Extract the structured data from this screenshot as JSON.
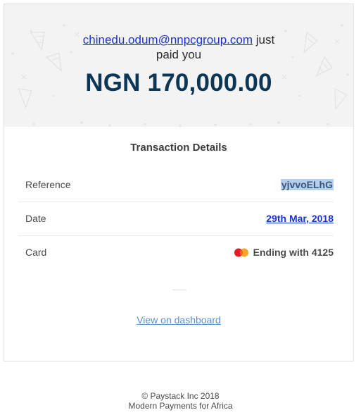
{
  "hero": {
    "email": "chinedu.odum@nnpcgroup.com",
    "paid_text_1": "just",
    "paid_text_2": "paid you",
    "amount": "NGN 170,000.00"
  },
  "details": {
    "title": "Transaction Details",
    "rows": [
      {
        "label": "Reference",
        "value": "yjvvoELhG"
      },
      {
        "label": "Date",
        "value": "29th Mar, 2018"
      },
      {
        "label": "Card",
        "value": "Ending with 4125",
        "icon": "mastercard-icon"
      }
    ],
    "dashboard_link": "View on dashboard"
  },
  "footer": {
    "line1": "© Paystack Inc 2018",
    "line2": "Modern Payments for Africa"
  },
  "colors": {
    "accent_link": "#1a32d6",
    "amount": "#0c3656",
    "hero_bg": "#f3f3f3",
    "dashboard_link": "#5a8fd0",
    "selection": "#b4cfee"
  }
}
